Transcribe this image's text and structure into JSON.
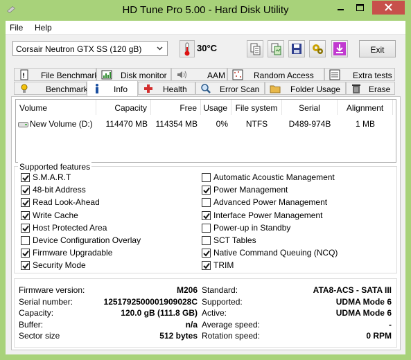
{
  "window": {
    "title": "HD Tune Pro 5.00 - Hard Disk Utility",
    "controls": {
      "minimize": "minimize-icon",
      "maximize": "maximize-icon",
      "close": "close-icon"
    }
  },
  "menu": {
    "file": "File",
    "help": "Help"
  },
  "toolbar": {
    "drive": "Corsair Neutron GTX SS (120 gB)",
    "temperature": "30°C",
    "exit": "Exit",
    "icons": [
      "copy-info-icon",
      "copy-screenshot-icon",
      "save-icon",
      "options-icon",
      "download-icon"
    ]
  },
  "tabs": {
    "row1": [
      "File Benchmark",
      "Disk monitor",
      "AAM",
      "Random Access",
      "Extra tests"
    ],
    "row2": [
      "Benchmark",
      "Info",
      "Health",
      "Error Scan",
      "Folder Usage",
      "Erase"
    ],
    "active": "Info"
  },
  "volumes": {
    "headers": [
      "Volume",
      "Capacity",
      "Free",
      "Usage",
      "File system",
      "Serial",
      "Alignment"
    ],
    "rows": [
      {
        "volume": "New Volume (D:)",
        "capacity": "114470 MB",
        "free": "114354 MB",
        "usage": "0%",
        "fs": "NTFS",
        "serial": "D489-974B",
        "alignment": "1 MB"
      }
    ]
  },
  "features": {
    "legend": "Supported features",
    "left": [
      {
        "label": "S.M.A.R.T",
        "checked": true
      },
      {
        "label": "48-bit Address",
        "checked": true
      },
      {
        "label": "Read Look-Ahead",
        "checked": true
      },
      {
        "label": "Write Cache",
        "checked": true
      },
      {
        "label": "Host Protected Area",
        "checked": true
      },
      {
        "label": "Device Configuration Overlay",
        "checked": false
      },
      {
        "label": "Firmware Upgradable",
        "checked": true
      },
      {
        "label": "Security Mode",
        "checked": true
      }
    ],
    "right": [
      {
        "label": "Automatic Acoustic Management",
        "checked": false
      },
      {
        "label": "Power Management",
        "checked": true
      },
      {
        "label": "Advanced Power Management",
        "checked": false
      },
      {
        "label": "Interface Power Management",
        "checked": true
      },
      {
        "label": "Power-up in Standby",
        "checked": false
      },
      {
        "label": "SCT Tables",
        "checked": false
      },
      {
        "label": "Native Command Queuing (NCQ)",
        "checked": true
      },
      {
        "label": "TRIM",
        "checked": true
      }
    ]
  },
  "info": {
    "left": [
      {
        "label": "Firmware version:",
        "value": "M206"
      },
      {
        "label": "Serial number:",
        "value": "1251792500001909028C"
      },
      {
        "label": "Capacity:",
        "value": "120.0 gB (111.8 GB)"
      },
      {
        "label": "Buffer:",
        "value": "n/a"
      },
      {
        "label": "Sector size",
        "value": "512 bytes"
      }
    ],
    "right": [
      {
        "label": "Standard:",
        "value": "ATA8-ACS - SATA III"
      },
      {
        "label": "Supported:",
        "value": "UDMA Mode 6"
      },
      {
        "label": "Active:",
        "value": "UDMA Mode 6"
      },
      {
        "label": "Average speed:",
        "value": "-"
      },
      {
        "label": "Rotation speed:",
        "value": "0 RPM"
      }
    ]
  }
}
